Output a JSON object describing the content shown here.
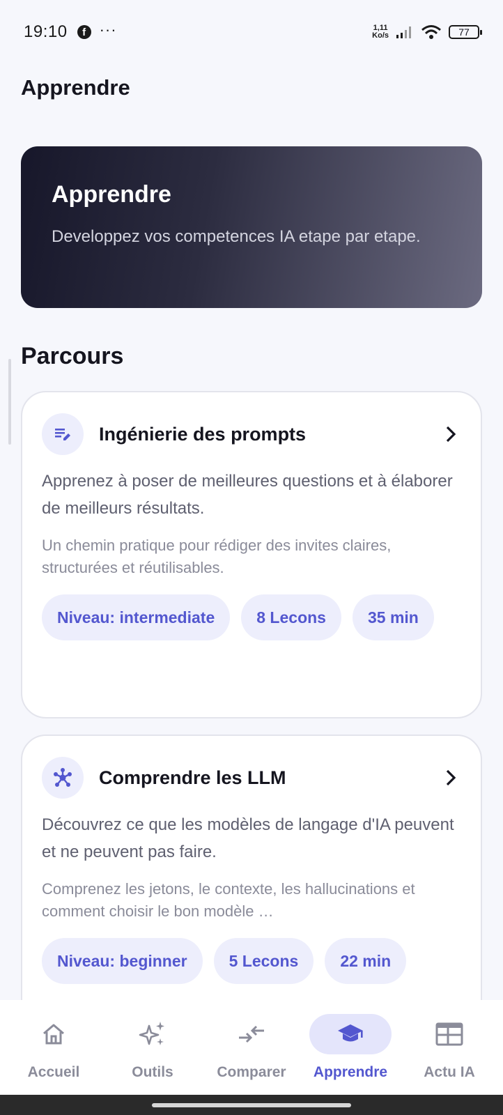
{
  "status_bar": {
    "time": "19:10",
    "facebook_glyph": "f",
    "more": "···",
    "net_speed_value": "1,11",
    "net_speed_unit": "Ko/s",
    "battery": "77"
  },
  "header": {
    "title": "Apprendre"
  },
  "hero": {
    "title": "Apprendre",
    "subtitle": "Developpez vos competences IA etape par etape."
  },
  "section": {
    "title": "Parcours"
  },
  "courses": [
    {
      "icon": "edit-list-icon",
      "title": "Ingénierie des prompts",
      "description": "Apprenez à poser de meilleures questions et à élaborer de meilleurs résultats.",
      "details": "Un chemin pratique pour rédiger des invites claires, structurées et réutilisables.",
      "level": "Niveau: intermediate",
      "lessons": "8 Lecons",
      "duration": "35 min"
    },
    {
      "icon": "network-icon",
      "title": "Comprendre les LLM",
      "description": "Découvrez ce que les modèles de langage d'IA peuvent et ne peuvent pas faire.",
      "details": "Comprenez les jetons, le contexte, les hallucinations et comment choisir le bon modèle …",
      "level": "Niveau: beginner",
      "lessons": "5 Lecons",
      "duration": "22 min"
    }
  ],
  "nav": [
    {
      "label": "Accueil",
      "icon": "home-icon",
      "active": false
    },
    {
      "label": "Outils",
      "icon": "sparkles-icon",
      "active": false
    },
    {
      "label": "Comparer",
      "icon": "compare-arrows-icon",
      "active": false
    },
    {
      "label": "Apprendre",
      "icon": "graduation-cap-icon",
      "active": true
    },
    {
      "label": "Actu IA",
      "icon": "newspaper-icon",
      "active": false
    }
  ],
  "colors": {
    "accent": "#5357CF",
    "chip_bg": "#EDEEFC",
    "background": "#F6F7FC",
    "hero_start": "#17172A",
    "hero_end": "#6B6A80"
  }
}
